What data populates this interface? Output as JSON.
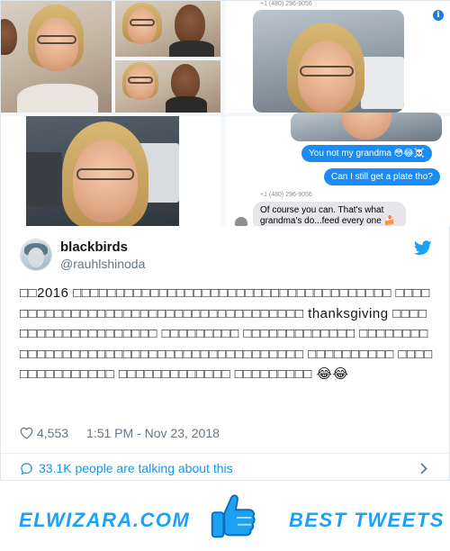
{
  "photos": {
    "phone_number_top": "+1 (480) 296-9056",
    "phone_number_mid": "+1 (480) 296-9056",
    "messages": [
      {
        "from": "me",
        "text": "You not my grandma 😳😂☠️"
      },
      {
        "from": "me",
        "text": "Can I still get a plate tho?"
      },
      {
        "from": "them",
        "text": "Of course you can.  That's what grandma's do...feed every one 🍰"
      }
    ]
  },
  "tweet": {
    "display_name": "blackbirds",
    "handle": "@rauhlshinoda",
    "text": "□□2016 □□□□□□□□□□□□□□□□□□□□□□□□□□□□□□□□□□□□□ □□□□□□□□□□□□□□□□□□□□□□□□□□□□□□□□□□□□□ thanksgiving □□□□□□□□□□□□□□□□□□□□ □□□□□□□□□ □□□□□□□□□□□□□ □□□□□□□□□□□□□□□□□□□□□□□□□□□□□□□□□□□□□□□□□ □□□□□□□□□□ □□□□□□□□□□□□□□□ □□□□□□□□□□□□□ □□□□□□□□□ 😂😂",
    "likes": "4,553",
    "timestamp": "1:51 PM - Nov 23, 2018",
    "talking": "33.1K people are talking about this"
  },
  "footer": {
    "brand_left": "ELWIZARA.COM",
    "brand_right": "BEST TWEETS"
  },
  "colors": {
    "twitter_blue": "#1da1f2",
    "link_blue": "#1b95e0",
    "imessage_blue": "#1b8cf5"
  },
  "icons": [
    "twitter-bird-icon",
    "heart-icon",
    "comment-bubble-icon",
    "chevron-right-icon",
    "info-icon",
    "thumbs-up-icon"
  ]
}
